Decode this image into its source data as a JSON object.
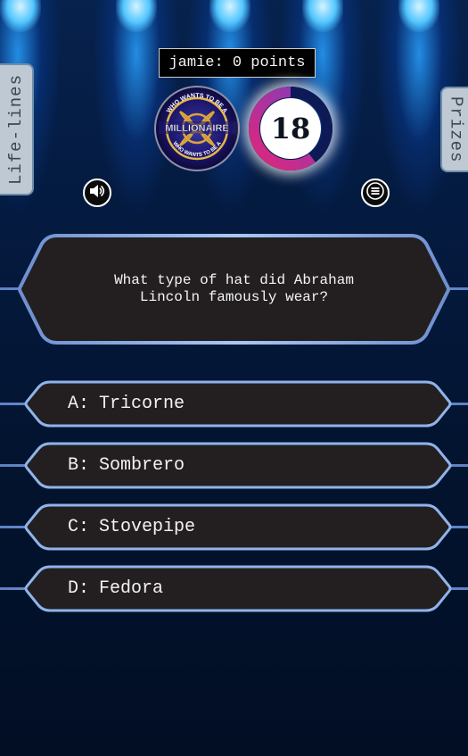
{
  "player": {
    "name": "jamie",
    "points": 0,
    "score_text": "jamie: 0 points"
  },
  "timer": {
    "seconds": "18",
    "remaining_fraction": 0.6
  },
  "logo": {
    "ring_top": "WHO WANTS TO BE A",
    "center": "MILLIONAIRE",
    "ring_bottom": "WHO WANTS TO BE A"
  },
  "side_tabs": {
    "lifelines": "Life-lines",
    "prizes": "Prizes"
  },
  "question": {
    "text": "What type of hat did Abraham Lincoln famously wear?"
  },
  "answers": [
    {
      "letter": "A:",
      "text": "Tricorne"
    },
    {
      "letter": "B:",
      "text": "Sombrero"
    },
    {
      "letter": "C:",
      "text": "Stovepipe"
    },
    {
      "letter": "D:",
      "text": "Fedora"
    }
  ],
  "icons": {
    "sound": "speaker-icon",
    "menu": "menu-icon"
  },
  "colors": {
    "panel": "#231f20",
    "panel_border": "#8fb4ea",
    "timer_progress_start": "#e0267a",
    "timer_progress_end": "#7a3fc1",
    "timer_track": "#0d1a55",
    "background": "#03132e"
  }
}
